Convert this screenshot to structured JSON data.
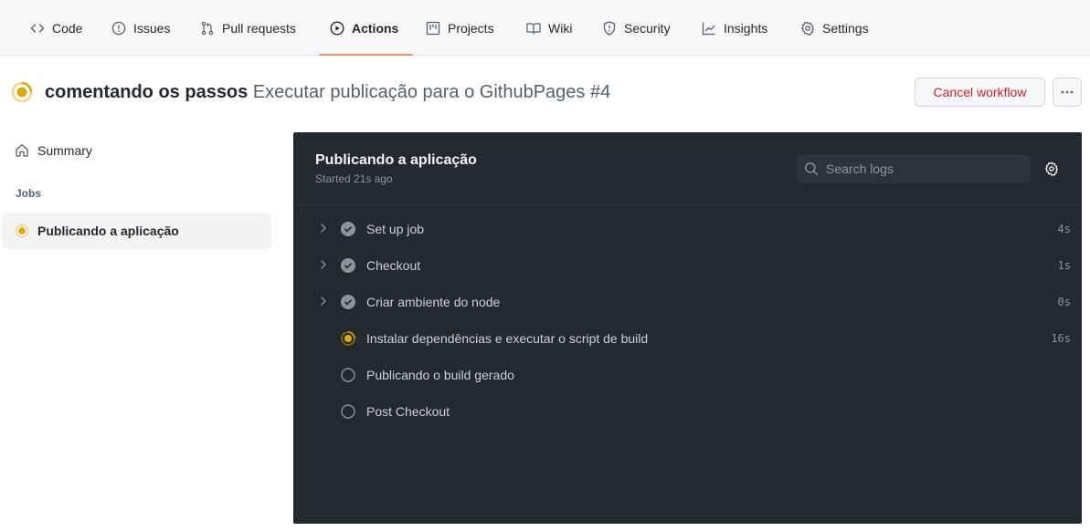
{
  "nav": {
    "items": [
      {
        "label": "Code",
        "icon": "code-icon",
        "active": false
      },
      {
        "label": "Issues",
        "icon": "issue-icon",
        "active": false
      },
      {
        "label": "Pull requests",
        "icon": "pull-request-icon",
        "active": false
      },
      {
        "label": "Actions",
        "icon": "play-icon",
        "active": true
      },
      {
        "label": "Projects",
        "icon": "project-icon",
        "active": false
      },
      {
        "label": "Wiki",
        "icon": "book-icon",
        "active": false
      },
      {
        "label": "Security",
        "icon": "shield-icon",
        "active": false
      },
      {
        "label": "Insights",
        "icon": "graph-icon",
        "active": false
      },
      {
        "label": "Settings",
        "icon": "gear-icon",
        "active": false
      }
    ],
    "active_underline_color": "#fd8c73"
  },
  "run": {
    "status": "in_progress",
    "commit_message": "comentando os passos",
    "workflow_name": "Executar publicação para o GithubPages #4",
    "cancel_label": "Cancel workflow",
    "more_label": "···"
  },
  "sidebar": {
    "summary_label": "Summary",
    "jobs_heading": "Jobs",
    "jobs": [
      {
        "label": "Publicando a aplicação",
        "status": "in_progress"
      }
    ]
  },
  "job": {
    "title": "Publicando a aplicação",
    "started": "Started 21s ago",
    "search_placeholder": "Search logs",
    "steps": [
      {
        "name": "Set up job",
        "status": "success",
        "duration": "4s",
        "expandable": true
      },
      {
        "name": "Checkout",
        "status": "success",
        "duration": "1s",
        "expandable": true
      },
      {
        "name": "Criar ambiente do node",
        "status": "success",
        "duration": "0s",
        "expandable": true
      },
      {
        "name": "Instalar dependências e executar o script de build",
        "status": "in_progress",
        "duration": "16s",
        "expandable": false
      },
      {
        "name": "Publicando o build gerado",
        "status": "queued",
        "duration": "",
        "expandable": false
      },
      {
        "name": "Post Checkout",
        "status": "queued",
        "duration": "",
        "expandable": false
      }
    ]
  },
  "colors": {
    "in_progress": "#dbab0a",
    "cancel_text": "#cf222e",
    "panel_bg": "#24292f"
  }
}
